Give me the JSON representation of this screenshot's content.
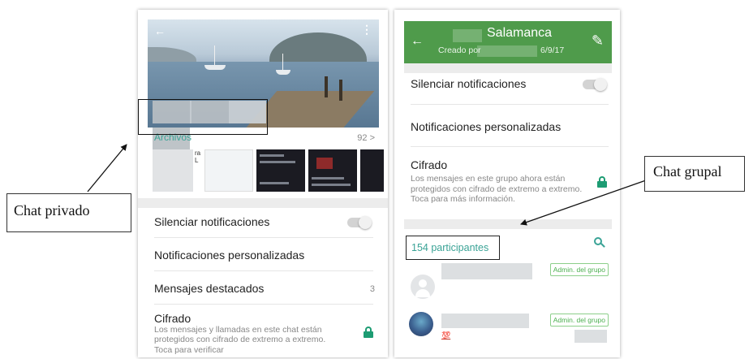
{
  "left_phone": {
    "archivos_label": "Archivos",
    "archivos_count": "92 >",
    "thumb_text": "ra L",
    "settings": {
      "mute": "Silenciar notificaciones",
      "custom": "Notificaciones personalizadas",
      "starred": "Mensajes destacados",
      "starred_count": "3",
      "encryption_title": "Cifrado",
      "encryption_desc": "Los mensajes y llamadas en este chat están protegidos con cifrado de extremo a extremo.",
      "encryption_cut": "Toca para verificar"
    },
    "icons": [
      "back-arrow-icon",
      "more-vert-icon",
      "lock-icon"
    ]
  },
  "right_phone": {
    "header": {
      "title": "Salamanca",
      "created_by": "Creado por",
      "date": "6/9/17"
    },
    "settings": {
      "mute": "Silenciar notificaciones",
      "custom": "Notificaciones personalizadas",
      "encryption_title": "Cifrado",
      "encryption_desc": "Los mensajes en este grupo ahora están protegidos con cifrado de extremo a extremo. Toca para más información."
    },
    "participants_label": "154 participantes",
    "members": [
      {
        "badge": "Admin. del grupo"
      },
      {
        "badge": "Admin. del grupo",
        "emoji": "💯"
      }
    ],
    "icons": [
      "back-arrow-icon",
      "edit-icon",
      "search-icon",
      "lock-icon"
    ]
  },
  "annotations": {
    "private": "Chat privado",
    "group": "Chat grupal"
  },
  "colors": {
    "header_green": "#4f9b4b",
    "teal": "#3aa396",
    "lock_green": "#1d9c73"
  }
}
